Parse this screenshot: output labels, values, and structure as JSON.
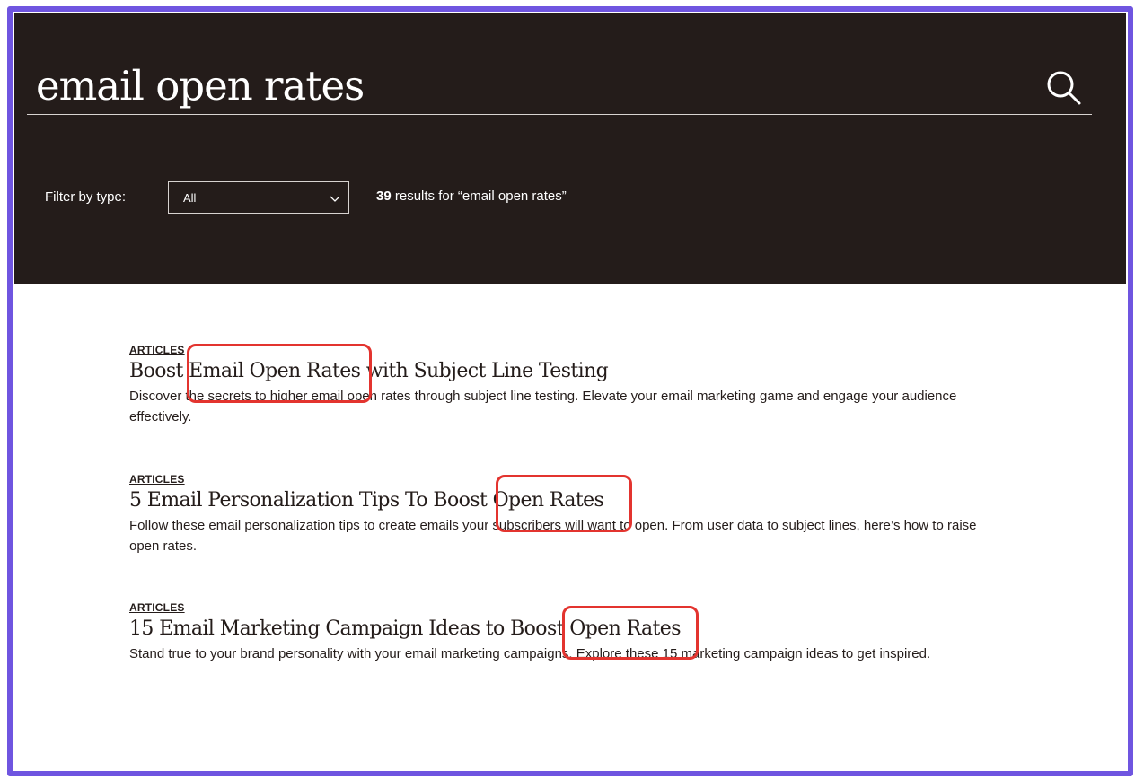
{
  "search": {
    "query": "email open rates"
  },
  "filter": {
    "label": "Filter by type:",
    "selected": "All"
  },
  "summary": {
    "count": "39",
    "text": " results for “email open rates”"
  },
  "results": [
    {
      "type": "ARTICLES",
      "title": "Boost Email Open Rates with Subject Line Testing",
      "description": "Discover the secrets to higher email open rates through subject line testing. Elevate your email marketing game and engage your audience effectively."
    },
    {
      "type": "ARTICLES",
      "title": "5 Email Personalization Tips To Boost Open Rates",
      "description": "Follow these email personalization tips to create emails your subscribers will want to open. From user data to subject lines, here’s how to raise open rates."
    },
    {
      "type": "ARTICLES",
      "title": "15 Email Marketing Campaign Ideas to Boost Open Rates",
      "description": "Stand true to your brand personality with your email marketing campaigns. Explore these 15 marketing campaign ideas to get inspired."
    }
  ],
  "colors": {
    "hero_background": "#241c1a",
    "frame_border": "#6f55e0",
    "highlight_annotation": "#e3342f"
  }
}
